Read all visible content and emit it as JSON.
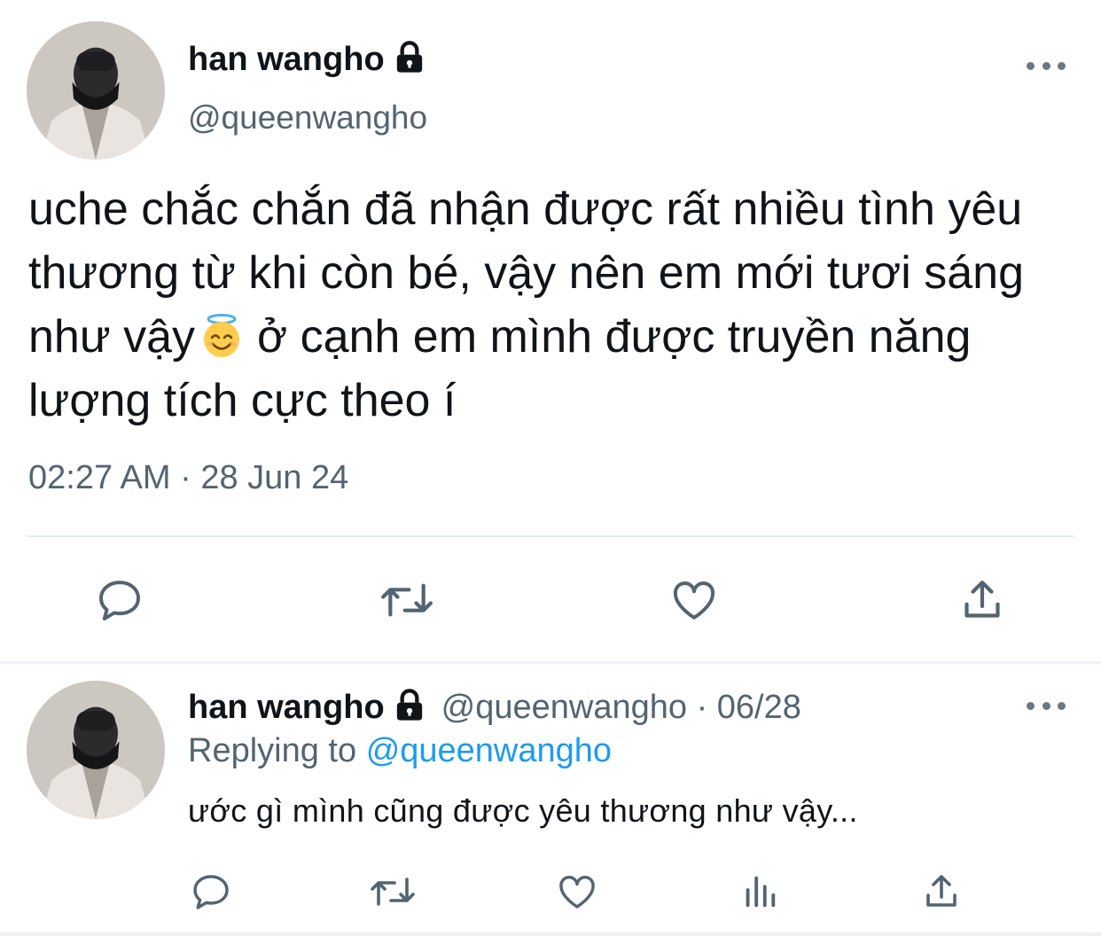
{
  "main_tweet": {
    "display_name": "han wangho",
    "handle": "@queenwangho",
    "text_before_emoji": "uche chắc chắn đã nhận được rất nhiều tình yêu thương từ khi còn bé, vậy nên em mới tươi sáng như vậy",
    "text_after_emoji": "ở cạnh em mình được truyền năng lượng tích cực theo í",
    "emoji": "smiling-face-with-halo",
    "timestamp": "02:27 AM · 28 Jun 24",
    "actions": [
      "reply-icon",
      "retweet-icon",
      "like-icon",
      "share-icon"
    ]
  },
  "reply": {
    "display_name": "han wangho",
    "handle_and_date": "@queenwangho · 06/28",
    "replying_prefix": "Replying to",
    "replying_handle": "@queenwangho",
    "text": "ước gì mình cũng được yêu thương như vậy...",
    "actions": [
      "reply-icon",
      "retweet-icon",
      "like-icon",
      "analytics-icon",
      "share-icon"
    ]
  },
  "colors": {
    "primary_text": "#0f1419",
    "secondary_text": "#536471",
    "link": "#1d9bf0",
    "icon": "#536471",
    "separator": "#e6ecf0"
  }
}
